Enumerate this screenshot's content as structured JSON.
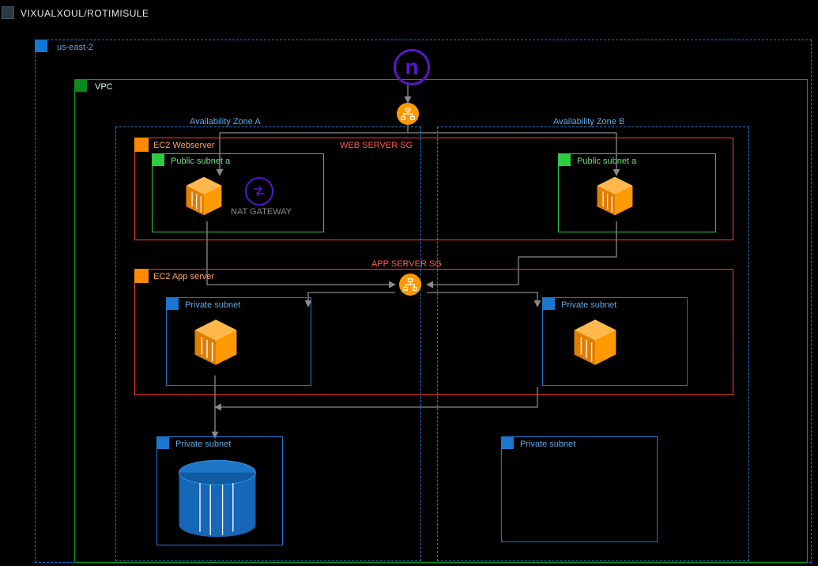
{
  "title": "VIXUALXOUL/ROTIMISULE",
  "region": "us-east-2",
  "vpc": "VPC",
  "az_a": "Availability Zone A",
  "az_b": "Availability Zone B",
  "web_sg": "WEB SERVER SG",
  "app_sg": "APP SERVER SG",
  "ec2_web": "EC2 Webserver",
  "ec2_app": "EC2 App server",
  "pub_a": "Public subnet a",
  "pub_b": "Public subnet a",
  "priv_a": "Private subnet",
  "priv_b": "Private subnet",
  "priv_db_a": "Private subnet",
  "priv_db_b": "Private subnet",
  "nat": "NAT GATEWAY",
  "colors": {
    "blue": "#1b78d0",
    "blue_text": "#5ea9e6",
    "green": "#00a418",
    "green_text": "#6ee37e",
    "green_box": "#2ecc40",
    "red": "#ff3b2f",
    "orange": "#ff8a00",
    "orange_fill": "#ff9900",
    "purple": "#5b16c9",
    "grey": "#8a8a8a",
    "dark_grey": "#4a4a4a"
  }
}
